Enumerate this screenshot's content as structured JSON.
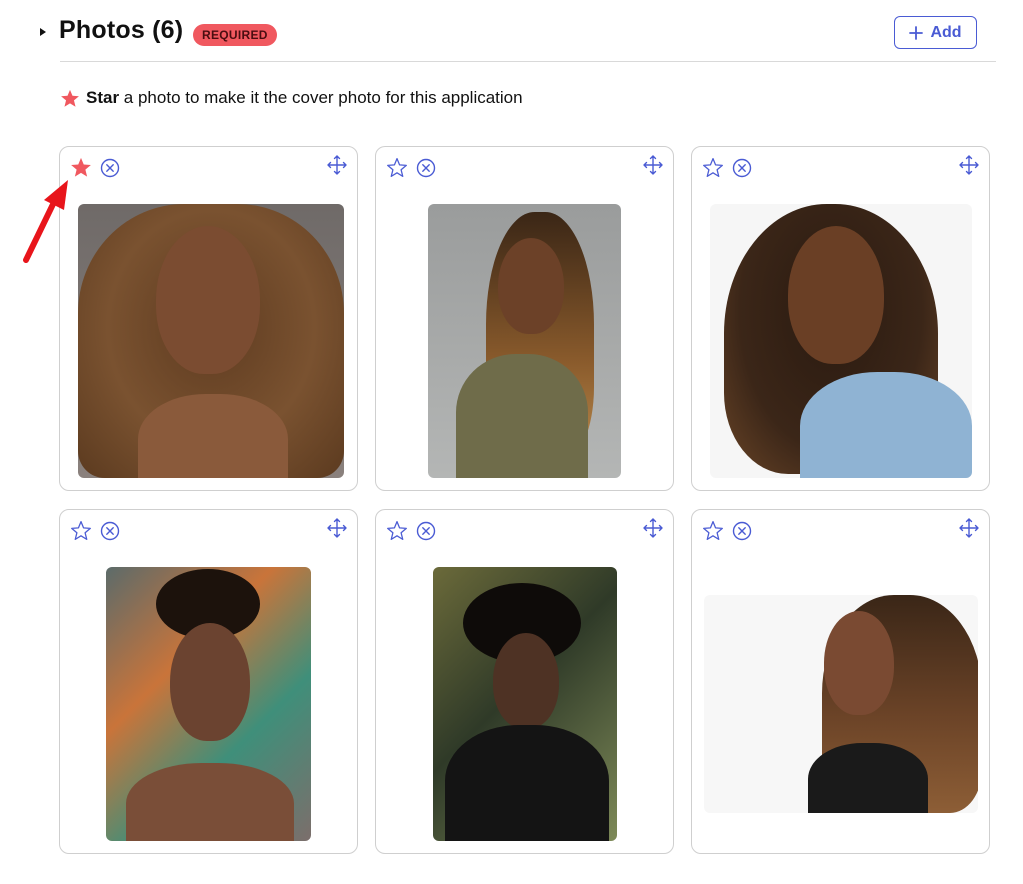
{
  "header": {
    "title": "Photos (6)",
    "badge": "REQUIRED",
    "add_label": "Add"
  },
  "hint": {
    "bold": "Star",
    "text": " a photo to make it the cover photo for this application"
  },
  "colors": {
    "accent": "#4a5bd4",
    "star_active": "#f0585f",
    "badge_bg": "#f0585f",
    "arrow": "#e8151b"
  },
  "photos": [
    {
      "starred": true
    },
    {
      "starred": false
    },
    {
      "starred": false
    },
    {
      "starred": false
    },
    {
      "starred": false
    },
    {
      "starred": false
    }
  ],
  "icons": {
    "star": "star-icon",
    "remove": "remove-circle-icon",
    "move": "move-arrows-icon",
    "add": "plus-icon"
  }
}
